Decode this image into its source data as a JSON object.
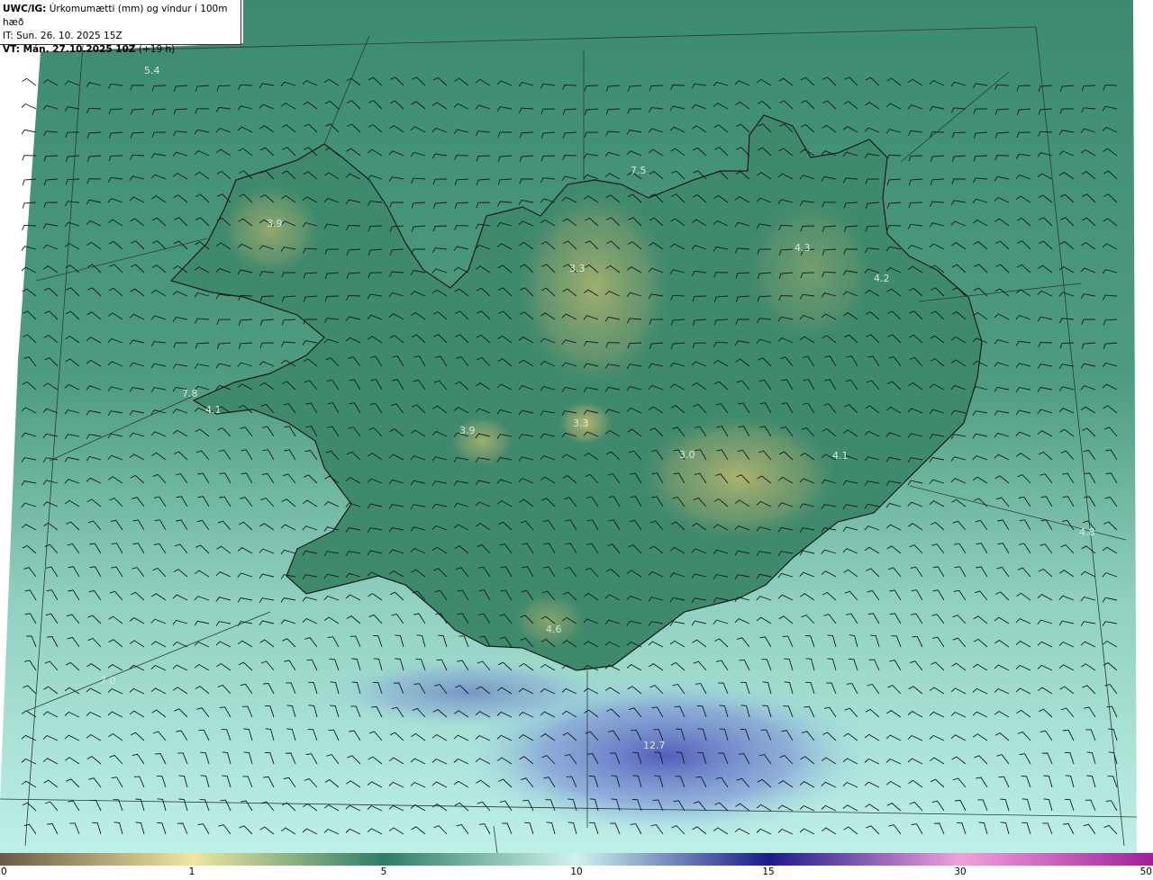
{
  "header": {
    "model": "UWC/IG:",
    "title": "Úrkomumætti (mm) og vindur í 100m hæð",
    "init_time": "IT: Sun. 26. 10. 2025 15Z",
    "valid_prefix": "VT: Mán. 27.10.2025 10Z",
    "valid_offset": "(+19 h)"
  },
  "colorbar": {
    "ticks": [
      "0",
      "1",
      "5",
      "10",
      "15",
      "30",
      "50"
    ],
    "stops": [
      "#6a5a45",
      "#f0e6a0",
      "#2f7d66",
      "#cff3ee",
      "#1a1a8a",
      "#f2a0dc",
      "#a0209a"
    ]
  },
  "map_labels": [
    {
      "text": "5.4"
    },
    {
      "text": "3.9"
    },
    {
      "text": "7.5"
    },
    {
      "text": "3.3"
    },
    {
      "text": "4.3"
    },
    {
      "text": "4.2"
    },
    {
      "text": "7.8"
    },
    {
      "text": "4.1"
    },
    {
      "text": "3.9"
    },
    {
      "text": "3.3"
    },
    {
      "text": "3.0"
    },
    {
      "text": "4.1"
    },
    {
      "text": "4.6"
    },
    {
      "text": "7.0"
    },
    {
      "text": "12.7"
    },
    {
      "text": "4.8"
    }
  ]
}
